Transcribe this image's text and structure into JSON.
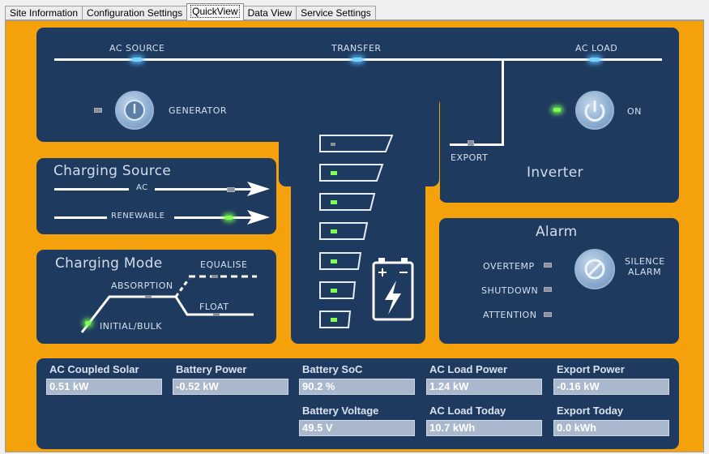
{
  "tabs": [
    "Site Information",
    "Configuration Settings",
    "QuickView",
    "Data View",
    "Service Settings"
  ],
  "active_tab": "QuickView",
  "power_flow": {
    "ac_source": "AC SOURCE",
    "transfer": "TRANSFER",
    "ac_load": "AC LOAD",
    "generator": "GENERATOR",
    "on": "ON",
    "export": "EXPORT",
    "inverter": "Inverter"
  },
  "charging_source": {
    "title": "Charging Source",
    "ac": "AC",
    "renewable": "RENEWABLE"
  },
  "charging_mode": {
    "title": "Charging Mode",
    "equalise": "EQUALISE",
    "absorption": "ABSORPTION",
    "float": "FLOAT",
    "initial_bulk": "INITIAL/BULK"
  },
  "battery": {
    "segments_total": 7,
    "segments_lit": 6,
    "plus": "+",
    "minus": "−"
  },
  "alarm": {
    "title": "Alarm",
    "overtemp": "OVERTEMP",
    "shutdown": "SHUTDOWN",
    "attention": "ATTENTION",
    "silence_line1": "SILENCE",
    "silence_line2": "ALARM"
  },
  "readings": {
    "ac_coupled_solar": {
      "label": "AC Coupled Solar",
      "value": "0.51 kW"
    },
    "battery_power": {
      "label": "Battery Power",
      "value": "-0.52 kW"
    },
    "battery_soc": {
      "label": "Battery SoC",
      "value": "90.2 %"
    },
    "ac_load_power": {
      "label": "AC Load Power",
      "value": "1.24 kW"
    },
    "export_power": {
      "label": "Export Power",
      "value": "-0.16 kW"
    },
    "battery_voltage": {
      "label": "Battery Voltage",
      "value": "49.5 V"
    },
    "ac_load_today": {
      "label": "AC Load Today",
      "value": "10.7 kWh"
    },
    "export_today": {
      "label": "Export Today",
      "value": "0.0 kWh"
    }
  },
  "icons": [
    "power-icon",
    "battery-icon",
    "lightning-icon",
    "cancel-icon",
    "arrow-right-icon"
  ],
  "colors": {
    "background": "#f5a10c",
    "panel": "#1f3a5f",
    "led_green": "#7cff4e",
    "led_blue": "#7ad3ff",
    "field": "#a9b8cc"
  }
}
